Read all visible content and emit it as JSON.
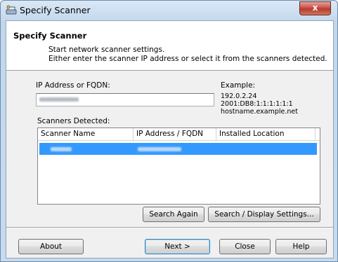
{
  "window": {
    "title": "Specify Scanner",
    "close_label": "x"
  },
  "header": {
    "title": "Specify Scanner",
    "description_line1": "Start network scanner settings.",
    "description_line2": "Either enter the scanner IP address or select it from the scanners detected."
  },
  "ip_field": {
    "label": "IP Address or FQDN:"
  },
  "example": {
    "label": "Example:",
    "lines": [
      "192.0.2.24",
      "2001:DB8:1:1:1:1:1:1",
      "hostname.example.net"
    ]
  },
  "scanners": {
    "label": "Scanners Detected:",
    "columns": [
      "Scanner Name",
      "IP Address / FQDN",
      "Installed Location"
    ]
  },
  "buttons": {
    "search_again": "Search Again",
    "search_display_settings": "Search / Display Settings...",
    "about": "About",
    "next": "Next >",
    "close": "Close",
    "help": "Help"
  },
  "colors": {
    "selection": "#3399ff",
    "close_button": "#c75050"
  }
}
